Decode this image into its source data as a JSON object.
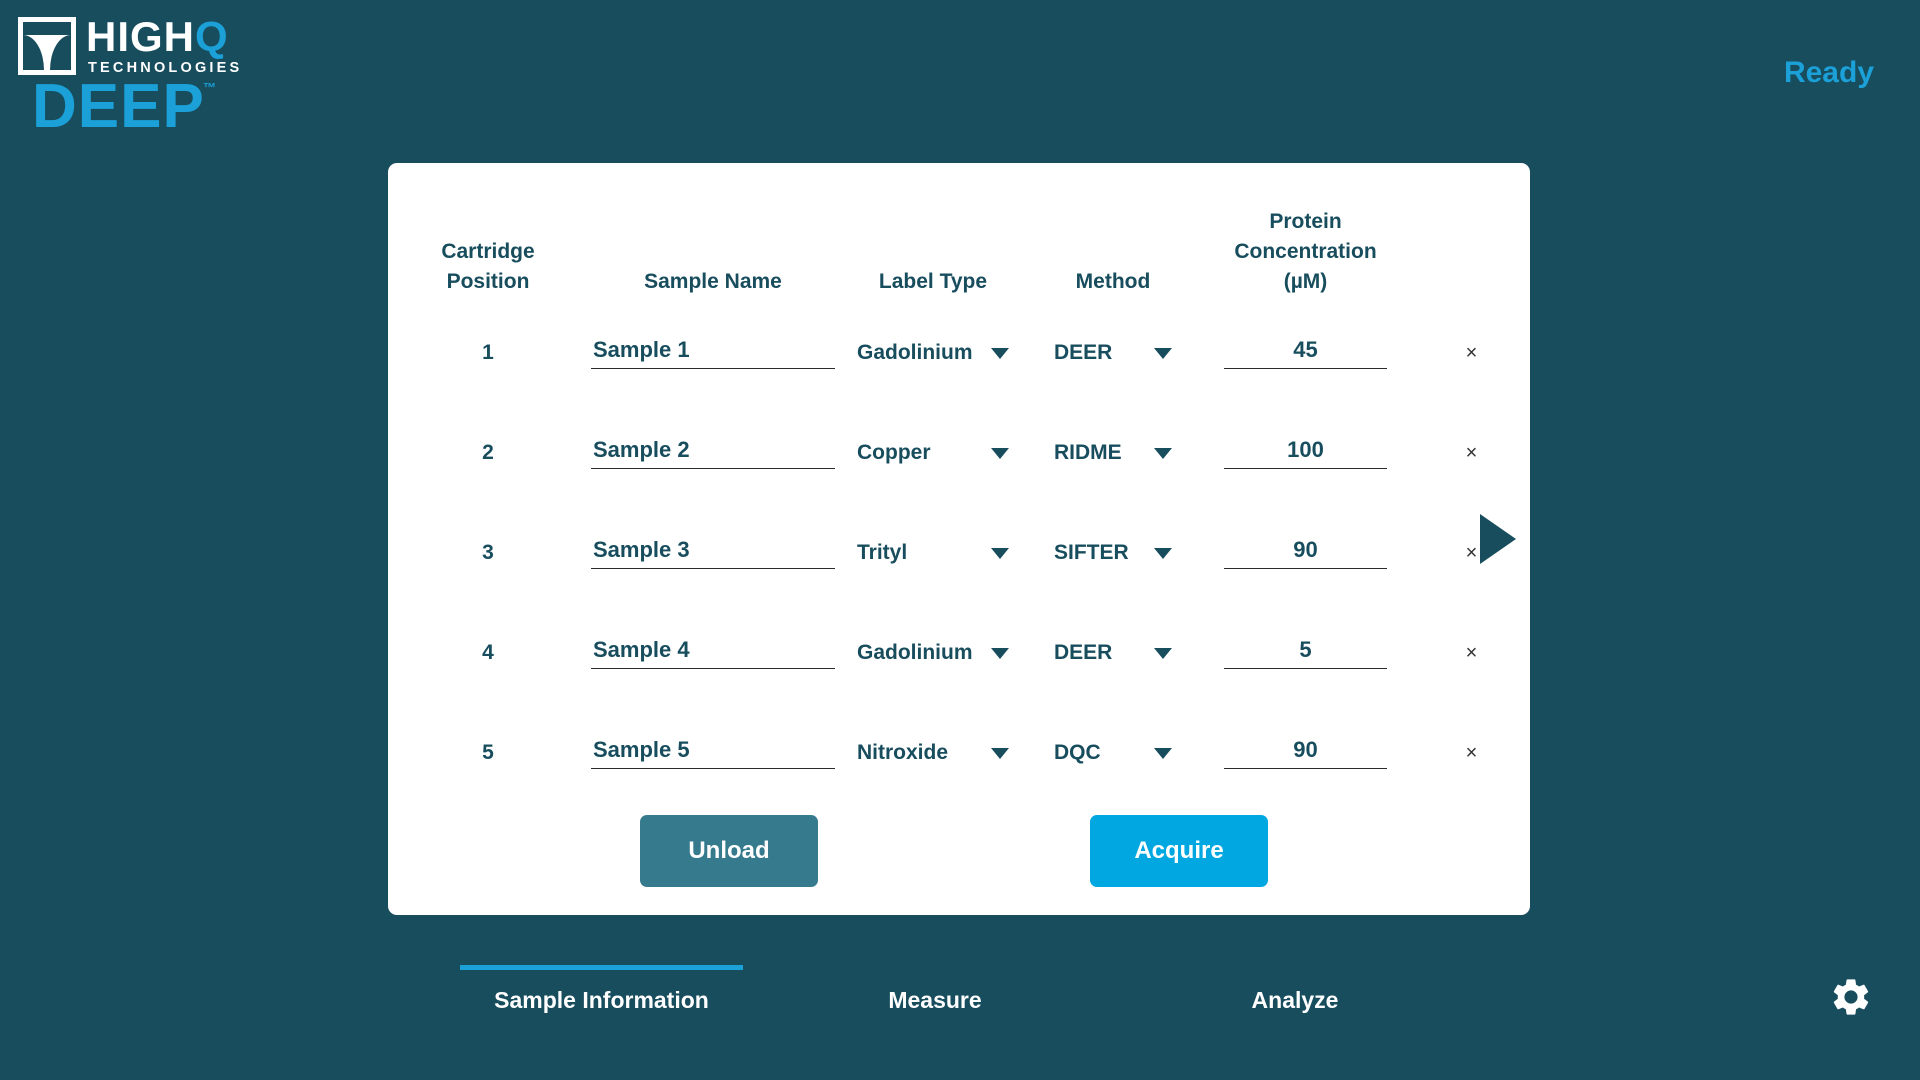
{
  "app": {
    "brand_top": "HIGH",
    "brand_top_accent": "Q",
    "brand_sub": "TECHNOLOGIES",
    "brand_main": "DEEP",
    "brand_tm": "™",
    "status": "Ready"
  },
  "colors": {
    "background": "#184D5E",
    "accent": "#1BA0D8",
    "acquire": "#00A7E1",
    "unload": "#357A8D",
    "card": "#FFFFFF",
    "text_dark": "#184D5E"
  },
  "table": {
    "headers": {
      "position": "Cartridge\nPosition",
      "position_line1": "Cartridge",
      "position_line2": "Position",
      "sample_name": "Sample Name",
      "label_type": "Label Type",
      "method": "Method",
      "concentration_line1": "Protein",
      "concentration_line2": "Concentration",
      "concentration_line3": "(µM)"
    },
    "remove_glyph": "×",
    "rows": [
      {
        "position": "1",
        "sample_name": "Sample 1",
        "label_type": "Gadolinium",
        "method": "DEER",
        "concentration": "45"
      },
      {
        "position": "2",
        "sample_name": "Sample 2",
        "label_type": "Copper",
        "method": "RIDME",
        "concentration": "100"
      },
      {
        "position": "3",
        "sample_name": "Sample 3",
        "label_type": "Trityl",
        "method": "SIFTER",
        "concentration": "90"
      },
      {
        "position": "4",
        "sample_name": "Sample 4",
        "label_type": "Gadolinium",
        "method": "DEER",
        "concentration": "5"
      },
      {
        "position": "5",
        "sample_name": "Sample 5",
        "label_type": "Nitroxide",
        "method": "DQC",
        "concentration": "90"
      }
    ],
    "label_type_options": [
      "Gadolinium",
      "Copper",
      "Trityl",
      "Nitroxide"
    ],
    "method_options": [
      "DEER",
      "RIDME",
      "SIFTER",
      "DQC"
    ]
  },
  "actions": {
    "unload": "Unload",
    "acquire": "Acquire"
  },
  "tabs": [
    {
      "label": "Sample Information",
      "active": true
    },
    {
      "label": "Measure",
      "active": false
    },
    {
      "label": "Analyze",
      "active": false
    }
  ],
  "icons": {
    "next": "play-arrow-icon",
    "settings": "gear-icon"
  }
}
